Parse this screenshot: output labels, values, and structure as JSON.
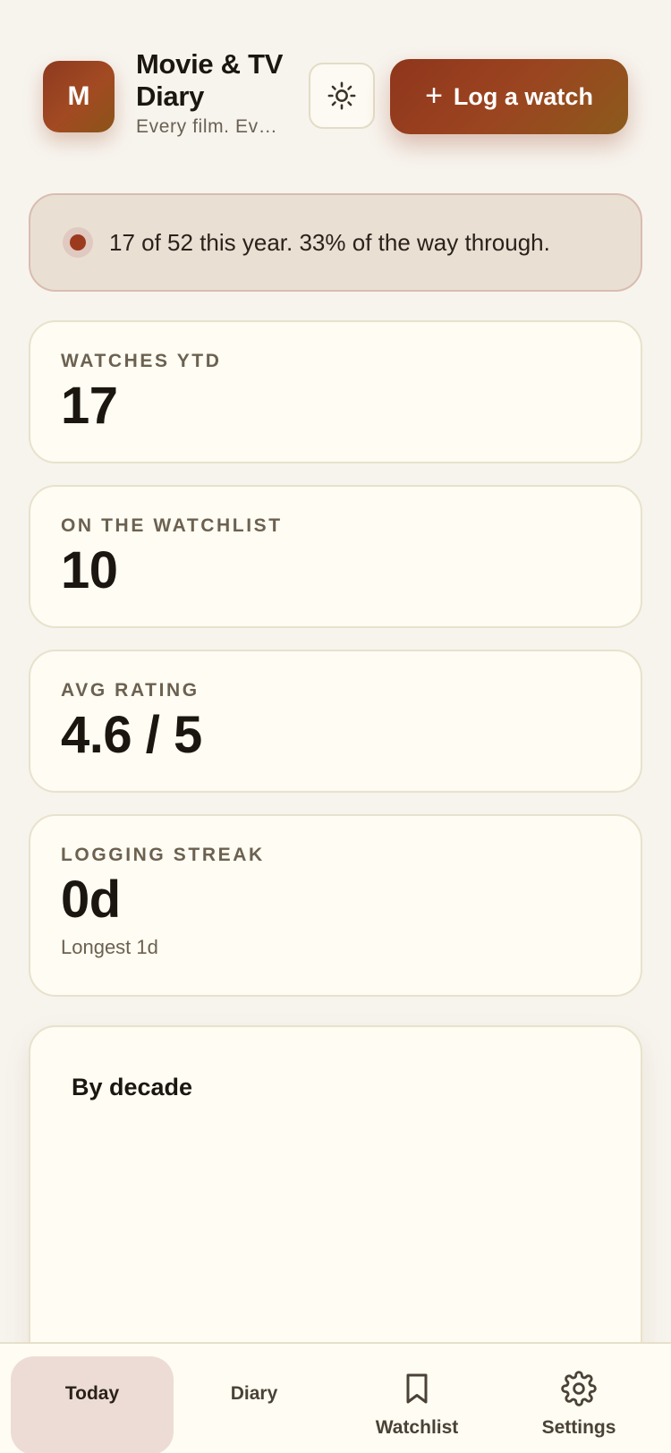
{
  "header": {
    "avatar_letter": "M",
    "title": "Movie & TV Diary",
    "subtitle": "Every film. Ev…",
    "theme_toggle_icon": "sun-icon",
    "log_button": {
      "icon": "plus-icon",
      "label": "Log a watch"
    }
  },
  "banner": {
    "text": "17 of 52 this year. 33% of the way through."
  },
  "stats": {
    "watches_ytd": {
      "label": "WATCHES YTD",
      "value": "17"
    },
    "watchlist": {
      "label": "ON THE WATCHLIST",
      "value": "10"
    },
    "avg_rating": {
      "label": "AVG RATING",
      "value": "4.6 / 5"
    },
    "streak": {
      "label": "LOGGING STREAK",
      "value": "0d",
      "sub": "Longest 1d"
    }
  },
  "decade": {
    "title": "By decade"
  },
  "nav": {
    "items": [
      {
        "label": "Today",
        "active": true
      },
      {
        "label": "Diary",
        "active": false
      },
      {
        "label": "Watchlist",
        "icon": "bookmark-icon",
        "active": false
      },
      {
        "label": "Settings",
        "icon": "gear-icon",
        "active": false
      }
    ]
  },
  "colors": {
    "accent": "#9b4420",
    "background": "#f7f4ee",
    "card": "#fefcf3",
    "banner": "#eadfd3",
    "nav_active": "#eddcd5"
  }
}
